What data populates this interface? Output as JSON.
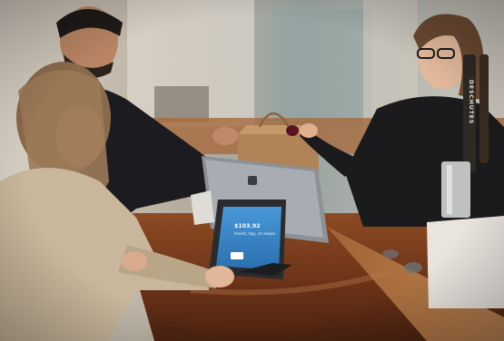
{
  "scene": {
    "pos_screen": {
      "amount": "$103.92",
      "prompt": "Insert, tap, or swipe"
    },
    "tap_handle": "DESCHUTES"
  },
  "colors": {
    "counter_wood": "#7a3d1e",
    "screen_blue": "#3a86c8",
    "jacket_beige": "#c9b79c",
    "shirt_black": "#1b1a1d"
  }
}
